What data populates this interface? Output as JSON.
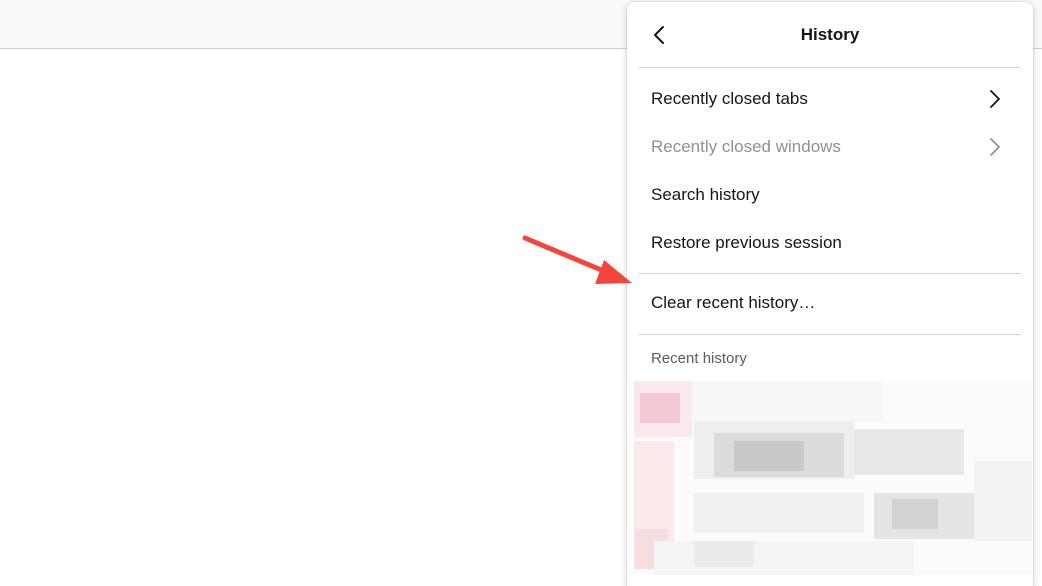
{
  "panel": {
    "title": "History",
    "back_icon": "chevron-left-icon",
    "items": [
      {
        "label": "Recently closed tabs",
        "disabled": false,
        "submenu_icon": "chevron-right-icon"
      },
      {
        "label": "Recently closed windows",
        "disabled": true,
        "submenu_icon": "chevron-right-icon"
      },
      {
        "label": "Search history",
        "disabled": false
      },
      {
        "label": "Restore previous session",
        "disabled": false
      }
    ],
    "clear_label": "Clear recent history…",
    "recent_label": "Recent history"
  },
  "annotation": {
    "icon": "red-arrow-icon",
    "color": "#f2463c"
  },
  "colors": {
    "text": "#15141a",
    "disabled_text": "#8f8f9d",
    "separator": "#cfcfd8",
    "toolbar_bg": "#f9f9fb"
  }
}
